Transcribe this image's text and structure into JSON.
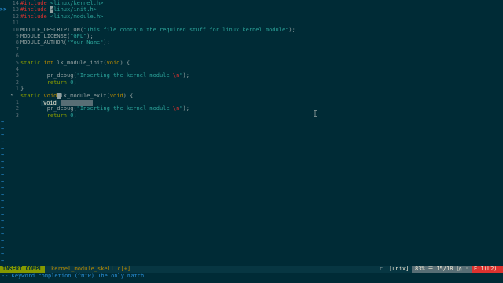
{
  "editor": {
    "lines": [
      {
        "sign": "",
        "num": "14",
        "code": [
          {
            "t": "#include ",
            "c": "pp"
          },
          {
            "t": "<linux/kernel.h>",
            "c": "str"
          }
        ]
      },
      {
        "sign": ">>",
        "num": "13",
        "code": [
          {
            "t": "#include ",
            "c": "pp"
          },
          {
            "t": "<",
            "c": "cursor-block"
          },
          {
            "t": "linux/init.h>",
            "c": "str"
          }
        ]
      },
      {
        "sign": "",
        "num": "12",
        "code": [
          {
            "t": "#include ",
            "c": "pp"
          },
          {
            "t": "<linux/module.h>",
            "c": "str"
          }
        ]
      },
      {
        "sign": "",
        "num": "11",
        "code": []
      },
      {
        "sign": "",
        "num": "10",
        "code": [
          {
            "t": "MODULE_DESCRIPTION(",
            "c": "fn"
          },
          {
            "t": "\"This file contain the required stuff for linux kernel module\"",
            "c": "str"
          },
          {
            "t": ");",
            "c": "fn"
          }
        ]
      },
      {
        "sign": "",
        "num": "9",
        "code": [
          {
            "t": "MODULE_LICENSE(",
            "c": "fn"
          },
          {
            "t": "\"GPL\"",
            "c": "str"
          },
          {
            "t": ");",
            "c": "fn"
          }
        ]
      },
      {
        "sign": "",
        "num": "8",
        "code": [
          {
            "t": "MODULE_AUTHOR(",
            "c": "fn"
          },
          {
            "t": "\"Your Name\"",
            "c": "str"
          },
          {
            "t": ");",
            "c": "fn"
          }
        ]
      },
      {
        "sign": "",
        "num": "7",
        "code": []
      },
      {
        "sign": "",
        "num": "6",
        "code": []
      },
      {
        "sign": "",
        "num": "5",
        "code": [
          {
            "t": "static ",
            "c": "kw"
          },
          {
            "t": "int ",
            "c": "ty"
          },
          {
            "t": "lk_module_init(",
            "c": "fn"
          },
          {
            "t": "void",
            "c": "ty"
          },
          {
            "t": ") {",
            "c": "fn"
          }
        ]
      },
      {
        "sign": "",
        "num": "4",
        "code": []
      },
      {
        "sign": "",
        "num": "3",
        "code": [
          {
            "t": "        pr_debug(",
            "c": "fn"
          },
          {
            "t": "\"Inserting the kernel module ",
            "c": "str"
          },
          {
            "t": "\\n",
            "c": "pp"
          },
          {
            "t": "\"",
            "c": "str"
          },
          {
            "t": ");",
            "c": "fn"
          }
        ]
      },
      {
        "sign": "",
        "num": "2",
        "code": [
          {
            "t": "        return ",
            "c": "kw"
          },
          {
            "t": "0",
            "c": "str"
          },
          {
            "t": ";",
            "c": "fn"
          }
        ]
      },
      {
        "sign": "",
        "num": "1",
        "code": [
          {
            "t": "}",
            "c": "fn"
          }
        ]
      },
      {
        "sign": "",
        "num": "15",
        "code": [
          {
            "t": "static ",
            "c": "kw"
          },
          {
            "t": "void",
            "c": "ty"
          },
          {
            "t": " ",
            "c": "cursor-block"
          },
          {
            "t": "lk_module_exit(",
            "c": "fn"
          },
          {
            "t": "void",
            "c": "ty"
          },
          {
            "t": ") {",
            "c": "fn"
          }
        ],
        "current": true
      },
      {
        "sign": "",
        "num": "1",
        "code": []
      },
      {
        "sign": "",
        "num": "2",
        "code": [
          {
            "t": "        pr_debug(",
            "c": "fn"
          },
          {
            "t": "\"Inserting the kernel module ",
            "c": "str"
          },
          {
            "t": "\\n",
            "c": "pp"
          },
          {
            "t": "\"",
            "c": "str"
          },
          {
            "t": ");",
            "c": "fn"
          }
        ]
      },
      {
        "sign": "",
        "num": "3",
        "code": [
          {
            "t": "        return ",
            "c": "kw"
          },
          {
            "t": "0",
            "c": "str"
          },
          {
            "t": ";",
            "c": "fn"
          }
        ]
      }
    ],
    "tilde_glyph": "~",
    "tilde_count": 22
  },
  "completion_popup": {
    "items": [
      "void"
    ],
    "selected_index": 0
  },
  "statusline": {
    "mode": "INSERT COMPL",
    "filename": "kernel_module_skell.c[+]",
    "filetype": "c",
    "fileformat": "[unix]",
    "position": "83% ☰ 15/18 ㏑ : 8",
    "errors": "E:1(L2)"
  },
  "cmdline": {
    "message": "-- Keyword completion (^N^P) The only match"
  },
  "colors": {
    "background": "#002b36",
    "mode_bg": "#859900",
    "error_bg": "#dc322f",
    "string": "#2aa198",
    "preproc": "#dc322f",
    "type": "#b58900"
  }
}
